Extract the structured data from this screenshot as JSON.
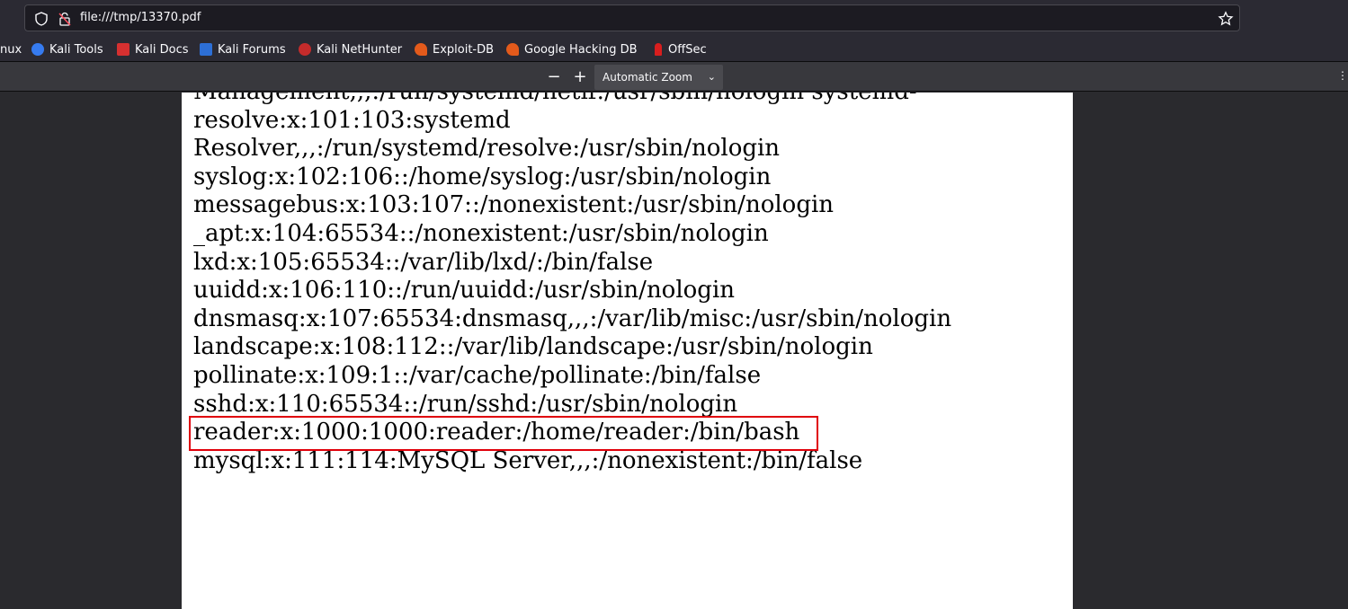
{
  "browser": {
    "url": "file:///tmp/13370.pdf",
    "bookmarks": [
      {
        "label": "nux",
        "icon": "none"
      },
      {
        "label": "Kali Tools",
        "icon": "kali-tools-icon"
      },
      {
        "label": "Kali Docs",
        "icon": "kali-docs-icon"
      },
      {
        "label": "Kali Forums",
        "icon": "kali-forums-icon"
      },
      {
        "label": "Kali NetHunter",
        "icon": "kali-nethunter-icon"
      },
      {
        "label": "Exploit-DB",
        "icon": "exploit-db-icon"
      },
      {
        "label": "Google Hacking DB",
        "icon": "ghdb-icon"
      },
      {
        "label": "OffSec",
        "icon": "offsec-icon"
      }
    ]
  },
  "pdf_toolbar": {
    "zoom_out": "−",
    "zoom_in": "+",
    "zoom_value": "Automatic Zoom"
  },
  "document": {
    "lines": [
      "Management,,,:/run/systemd/netif:/usr/sbin/nologin systemd-",
      "resolve:x:101:103:systemd",
      "Resolver,,,:/run/systemd/resolve:/usr/sbin/nologin",
      "syslog:x:102:106::/home/syslog:/usr/sbin/nologin",
      "messagebus:x:103:107::/nonexistent:/usr/sbin/nologin",
      "_apt:x:104:65534::/nonexistent:/usr/sbin/nologin",
      "lxd:x:105:65534::/var/lib/lxd/:/bin/false",
      "uuidd:x:106:110::/run/uuidd:/usr/sbin/nologin",
      "dnsmasq:x:107:65534:dnsmasq,,,:/var/lib/misc:/usr/sbin/nologin",
      "landscape:x:108:112::/var/lib/landscape:/usr/sbin/nologin",
      "pollinate:x:109:1::/var/cache/pollinate:/bin/false",
      "sshd:x:110:65534::/run/sshd:/usr/sbin/nologin",
      "reader:x:1000:1000:reader:/home/reader:/bin/bash",
      "mysql:x:111:114:MySQL Server,,,:/nonexistent:/bin/false"
    ],
    "highlight_color": "#e0000a"
  }
}
